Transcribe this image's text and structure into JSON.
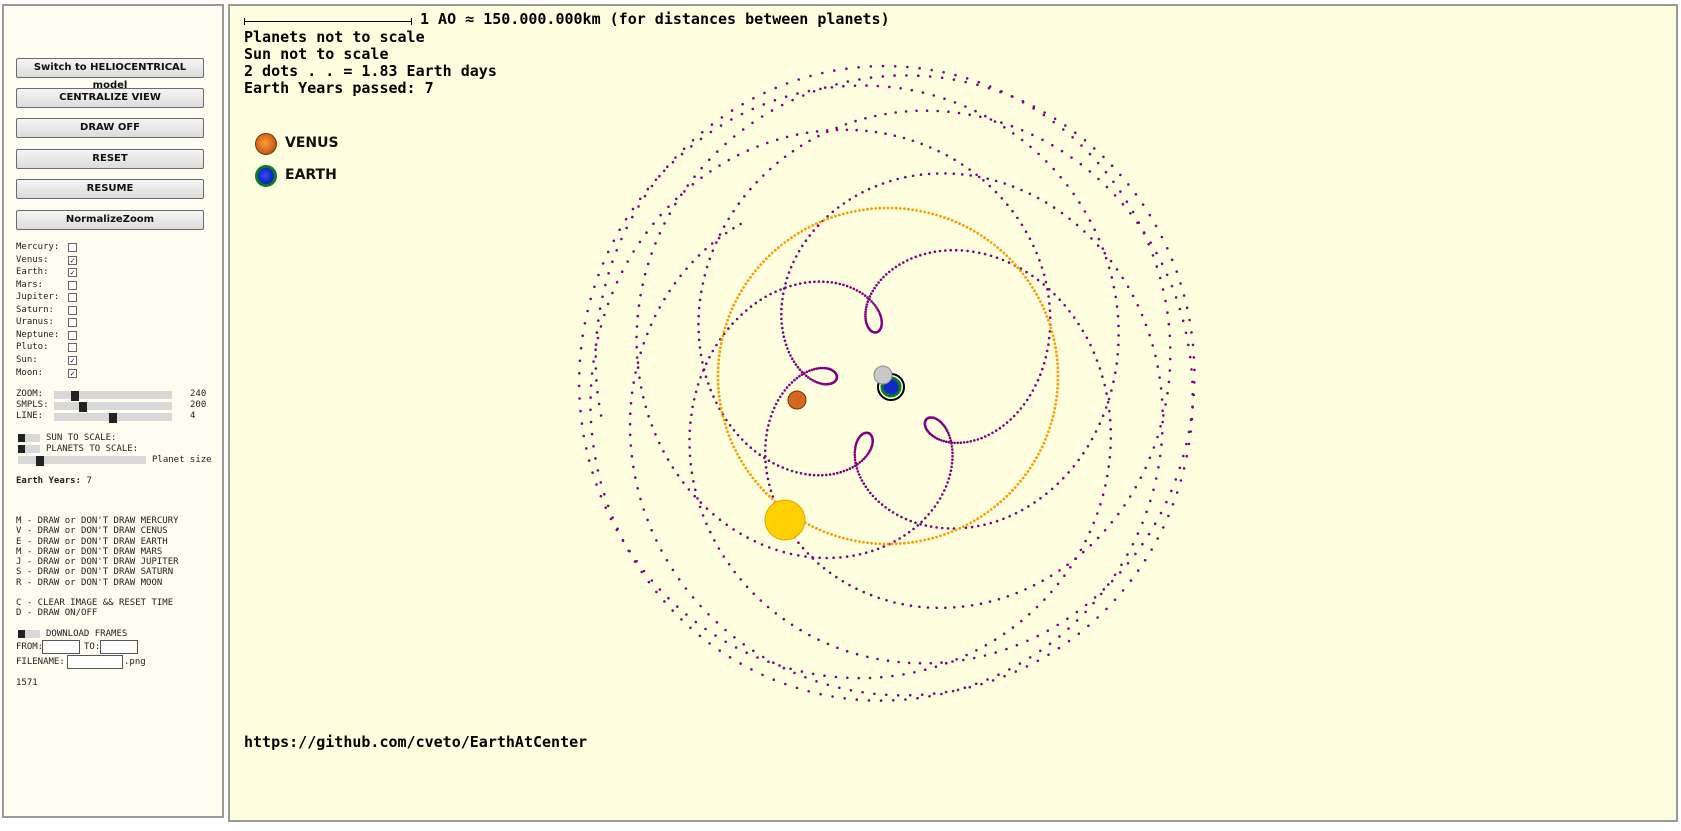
{
  "sidebar": {
    "buttons": {
      "switch_model": "Switch to HELIOCENTRICAL model",
      "centralize": "CENTRALIZE VIEW",
      "draw": "DRAW OFF",
      "reset": "RESET",
      "resume": "RESUME",
      "normalize_zoom": "NormalizeZoom"
    },
    "checkboxes": [
      {
        "label": "Mercury:",
        "checked": false
      },
      {
        "label": "Venus:",
        "checked": true
      },
      {
        "label": "Earth:",
        "checked": true
      },
      {
        "label": "Mars:",
        "checked": false
      },
      {
        "label": "Jupiter:",
        "checked": false
      },
      {
        "label": "Saturn:",
        "checked": false
      },
      {
        "label": "Uranus:",
        "checked": false
      },
      {
        "label": "Neptune:",
        "checked": false
      },
      {
        "label": "Pluto:",
        "checked": false
      },
      {
        "label": "Sun:",
        "checked": true
      },
      {
        "label": "Moon:",
        "checked": true
      }
    ],
    "sliders": {
      "zoom": {
        "label": "ZOOM:",
        "value": "240",
        "fraction": 0.15
      },
      "samples": {
        "label": "SMPLS:",
        "value": "200",
        "fraction": 0.23
      },
      "line": {
        "label": "LINE:",
        "value": "4",
        "fraction": 0.5
      }
    },
    "toggles": {
      "sun_to_scale": "SUN TO SCALE:",
      "planets_to_scale": "PLANETS TO SCALE:",
      "planet_size": "Planet size",
      "planet_size_fraction": 0.15
    },
    "earth_years": {
      "label": "Earth Years:",
      "value": "7"
    },
    "shortcuts": [
      "M - DRAW or DON'T DRAW MERCURY",
      "V - DRAW or DON'T DRAW CENUS",
      "E - DRAW or DON'T DRAW EARTH",
      "M - DRAW or DON'T DRAW MARS",
      "J - DRAW or DON'T DRAW JUPITER",
      "S - DRAW or DON'T DRAW SATURN",
      "R - DRAW or DON'T DRAW MOON"
    ],
    "shortcuts2": [
      "C - CLEAR IMAGE && RESET TIME",
      "D - DRAW ON/OFF"
    ],
    "download": {
      "label": "DOWNLOAD FRAMES",
      "from_label": "FROM:",
      "to_label": "TO:",
      "filename_label": "FILENAME:",
      "extension": ".png"
    },
    "frame_counter": "1571"
  },
  "canvas": {
    "scale_text": "1 AO ≈ 150.000.000km (for distances between planets)",
    "planets_scale": "Planets not to scale",
    "sun_scale": "Sun not to scale",
    "dots_info": "2 dots . . = 1.83 Earth days",
    "years_passed": "Earth Years passed: 7",
    "legend": [
      {
        "name": "VENUS",
        "color": "#d2691e"
      },
      {
        "name": "EARTH",
        "color": "#1028c8"
      }
    ],
    "github_url": "https://github.com/cveto/EarthAtCenter",
    "colors": {
      "background": "#ffffe0",
      "venus_trail": "#800080",
      "sun_trail": "#f5a000",
      "sun": "#ffd000",
      "moon": "#c8c8c8"
    }
  }
}
